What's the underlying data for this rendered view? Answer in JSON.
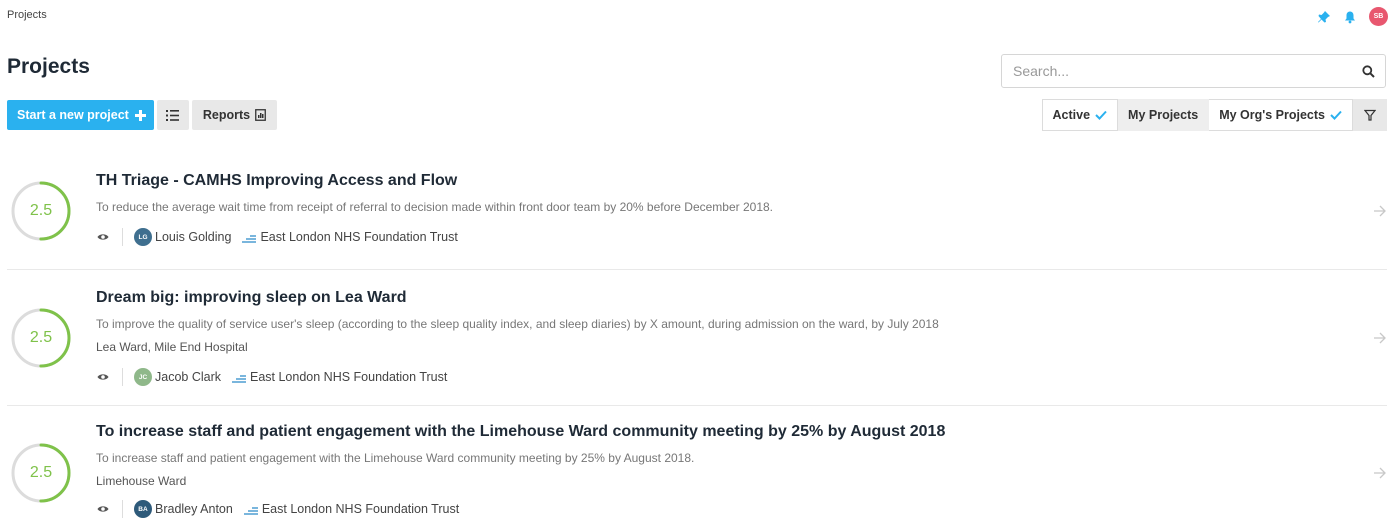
{
  "colors": {
    "accent": "#2ab1ef",
    "score_arc": "#7fc24a",
    "score_track": "#dcdcdc",
    "avatar_top": "#e8576f",
    "avatar_lg": "#3f6f8f",
    "avatar_jc": "#8fb88a",
    "avatar_ba": "#2e5a7a"
  },
  "header": {
    "breadcrumb": "Projects",
    "user_initials": "SB",
    "icons": [
      "pin-icon",
      "bell-icon"
    ]
  },
  "page_title": "Projects",
  "search": {
    "placeholder": "Search..."
  },
  "toolbar": {
    "new_project_label": "Start a new project",
    "reports_label": "Reports"
  },
  "filters": {
    "active_label": "Active",
    "my_projects_label": "My Projects",
    "my_org_label": "My Org's Projects"
  },
  "projects": [
    {
      "score": "2.5",
      "score_fraction": 0.5,
      "title": "TH Triage - CAMHS Improving Access and Flow",
      "description": "To reduce the average wait time from receipt of referral to decision made within front door team by 20% before December 2018.",
      "location": "",
      "user_initials": "LG",
      "user_name": "Louis Golding",
      "org": "East London NHS Foundation Trust"
    },
    {
      "score": "2.5",
      "score_fraction": 0.5,
      "title": "Dream big: improving sleep on Lea Ward",
      "description": "To improve the quality of service user's sleep (according to the sleep quality index, and sleep diaries) by X amount, during admission on the ward, by July 2018",
      "location": "Lea Ward, Mile End Hospital",
      "user_initials": "JC",
      "user_name": "Jacob Clark",
      "org": "East London NHS Foundation Trust"
    },
    {
      "score": "2.5",
      "score_fraction": 0.5,
      "title": "To increase staff and patient engagement with the Limehouse Ward community meeting by 25% by August 2018",
      "description": "To increase staff and patient engagement with the Limehouse Ward community meeting by 25% by August 2018.",
      "location": "Limehouse Ward",
      "user_initials": "BA",
      "user_name": "Bradley Anton",
      "org": "East London NHS Foundation Trust"
    }
  ]
}
